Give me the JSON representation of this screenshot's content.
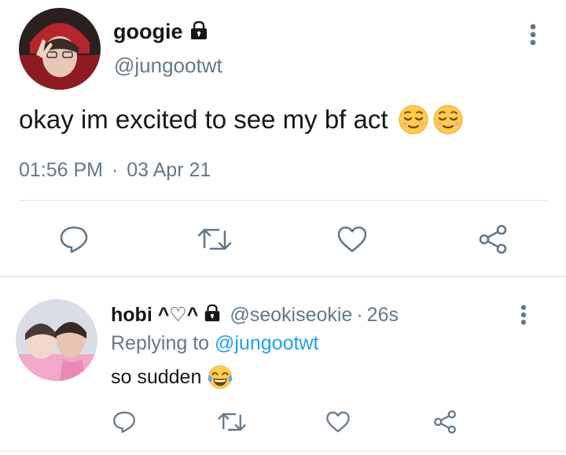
{
  "tweet": {
    "display_name": "googie",
    "handle": "@jungootwt",
    "text": "okay im excited to see my bf act",
    "emoji": "relieved-face",
    "time": "01:56 PM",
    "separator": "·",
    "date": "03 Apr 21"
  },
  "reply": {
    "display_name": "hobi ^♡^",
    "handle": "@seokiseokie",
    "separator": "·",
    "age": "26s",
    "replying_prefix": "Replying to",
    "replying_to": "@jungootwt",
    "text": "so sudden",
    "emoji": "tears-of-joy-face"
  },
  "icons": {
    "reply": "reply-icon",
    "retweet": "retweet-icon",
    "like": "heart-icon",
    "share": "share-icon",
    "more": "more-vertical-icon",
    "lock": "lock-icon"
  },
  "colors": {
    "accent": "#1da1f2",
    "muted_text": "#657786",
    "icon": "#657786",
    "divider": "#e1e8ed"
  }
}
